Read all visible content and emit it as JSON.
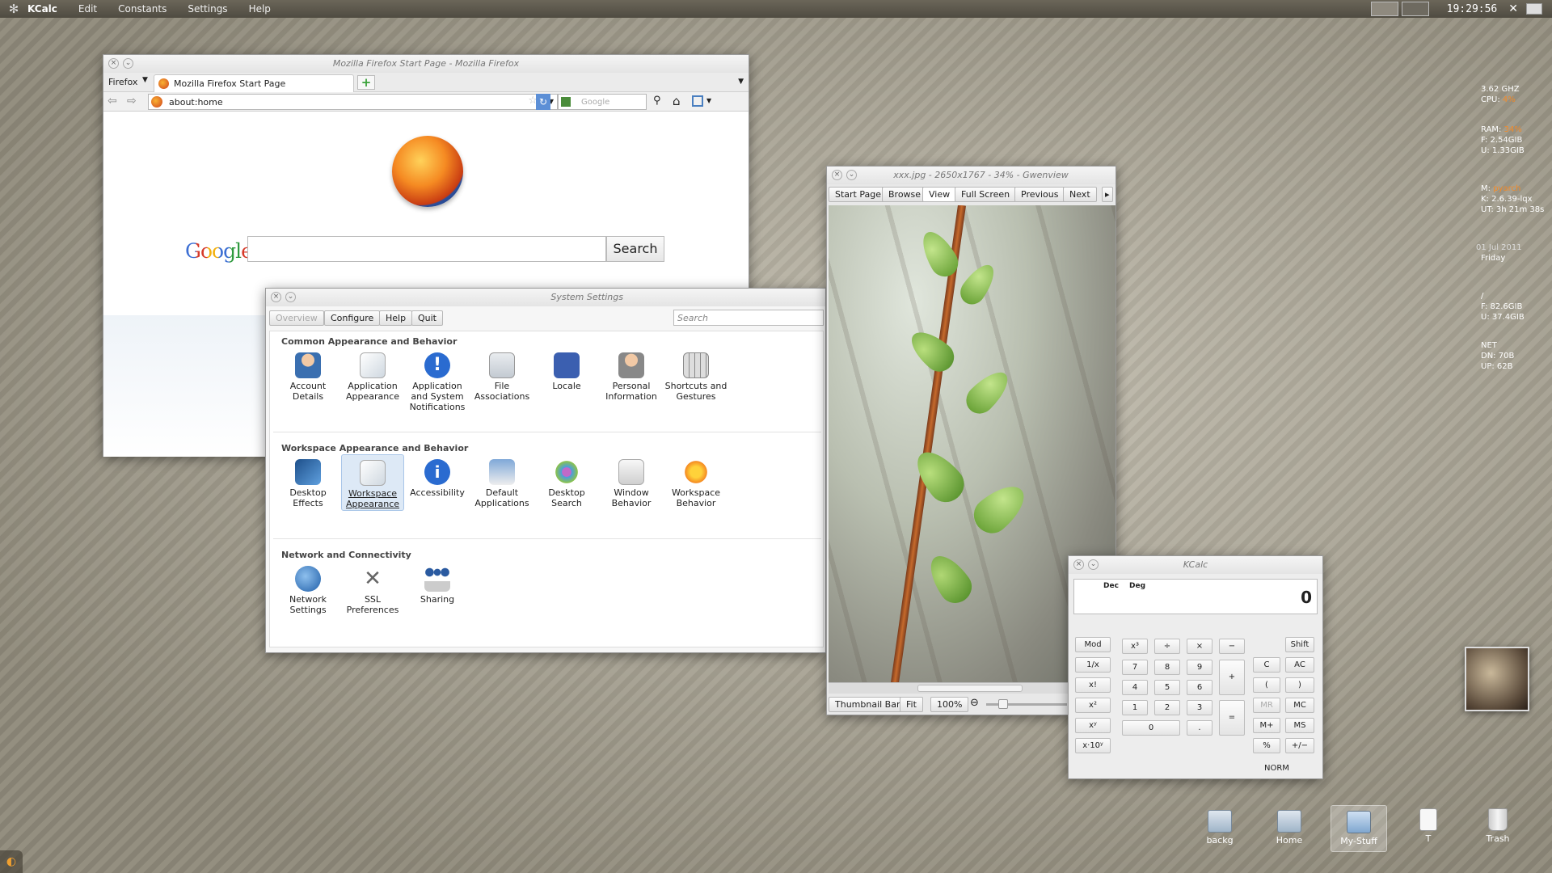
{
  "top_panel": {
    "app_name": "KCalc",
    "menus": [
      "Edit",
      "Constants",
      "Settings",
      "Help"
    ],
    "clock": "19:29:56"
  },
  "firefox": {
    "title": "Mozilla Firefox Start Page - Mozilla Firefox",
    "menu": "Firefox",
    "tab_label": "Mozilla Firefox Start Page",
    "url": "about:home",
    "search_placeholder": "Google",
    "google_logo": "Google",
    "search_button": "Search"
  },
  "system_settings": {
    "title": "System Settings",
    "toolbar": [
      "Overview",
      "Configure",
      "Help",
      "Quit"
    ],
    "search_placeholder": "Search",
    "sections": [
      {
        "heading": "Common Appearance and Behavior",
        "items": [
          "Account Details",
          "Application Appearance",
          "Application and System Notifications",
          "File Associations",
          "Locale",
          "Personal Information",
          "Shortcuts and Gestures"
        ]
      },
      {
        "heading": "Workspace Appearance and Behavior",
        "items": [
          "Desktop Effects",
          "Workspace Appearance",
          "Accessibility",
          "Default Applications",
          "Desktop Search",
          "Window Behavior",
          "Workspace Behavior"
        ]
      },
      {
        "heading": "Network and Connectivity",
        "items": [
          "Network Settings",
          "SSL Preferences",
          "Sharing"
        ]
      }
    ]
  },
  "gwenview": {
    "title": "xxx.jpg - 2650x1767 - 34% - Gwenview",
    "toolbar": [
      "Start Page",
      "Browse",
      "View",
      "Full Screen",
      "Previous",
      "Next"
    ],
    "bottom": [
      "Thumbnail Bar",
      "Fit",
      "100%"
    ]
  },
  "kcalc": {
    "title": "KCalc",
    "mode_dec": "Dec",
    "mode_deg": "Deg",
    "display": "0",
    "status": "NORM",
    "buttons": {
      "mod": "Mod",
      "recip": "1/x",
      "fact": "x!",
      "sq": "x²",
      "pow": "xʸ",
      "exp": "x·10ʸ",
      "x3": "x³",
      "div": "÷",
      "mul": "×",
      "sub": "−",
      "add": "+",
      "eq": "=",
      "n7": "7",
      "n8": "8",
      "n9": "9",
      "n4": "4",
      "n5": "5",
      "n6": "6",
      "n1": "1",
      "n2": "2",
      "n3": "3",
      "n0": "0",
      "dot": ".",
      "shift": "Shift",
      "c": "C",
      "ac": "AC",
      "lp": "(",
      "rp": ")",
      "mr": "MR",
      "mc": "MC",
      "mplus": "M+",
      "ms": "MS",
      "pct": "%",
      "pm": "+/−"
    }
  },
  "system_monitor": {
    "cpu_freq": "3.62 GHZ",
    "cpu_label": "CPU:",
    "cpu_value": "4%",
    "ram_label": "RAM:",
    "ram_value": "34%",
    "ram_free": "F: 2.54GIB",
    "ram_used": "U: 1.33GIB",
    "host_label": "M:",
    "host_value": "pyarch",
    "kernel": "K: 2.6.39-lqx",
    "uptime": "UT: 3h 21m 38s",
    "date": "01 Jul 2011",
    "day": "Friday",
    "disk_mount": "/",
    "disk_free": "F: 82.6GIB",
    "disk_used": "U: 37.4GIB",
    "net_label": "NET",
    "net_down": "DN: 70B",
    "net_up": "UP: 62B"
  },
  "desktop_icons": [
    "backg",
    "Home",
    "My-Stuff",
    "T",
    "Trash"
  ],
  "colors": {
    "accent_orange": "#f08a2a",
    "panel": "#5a564b"
  }
}
